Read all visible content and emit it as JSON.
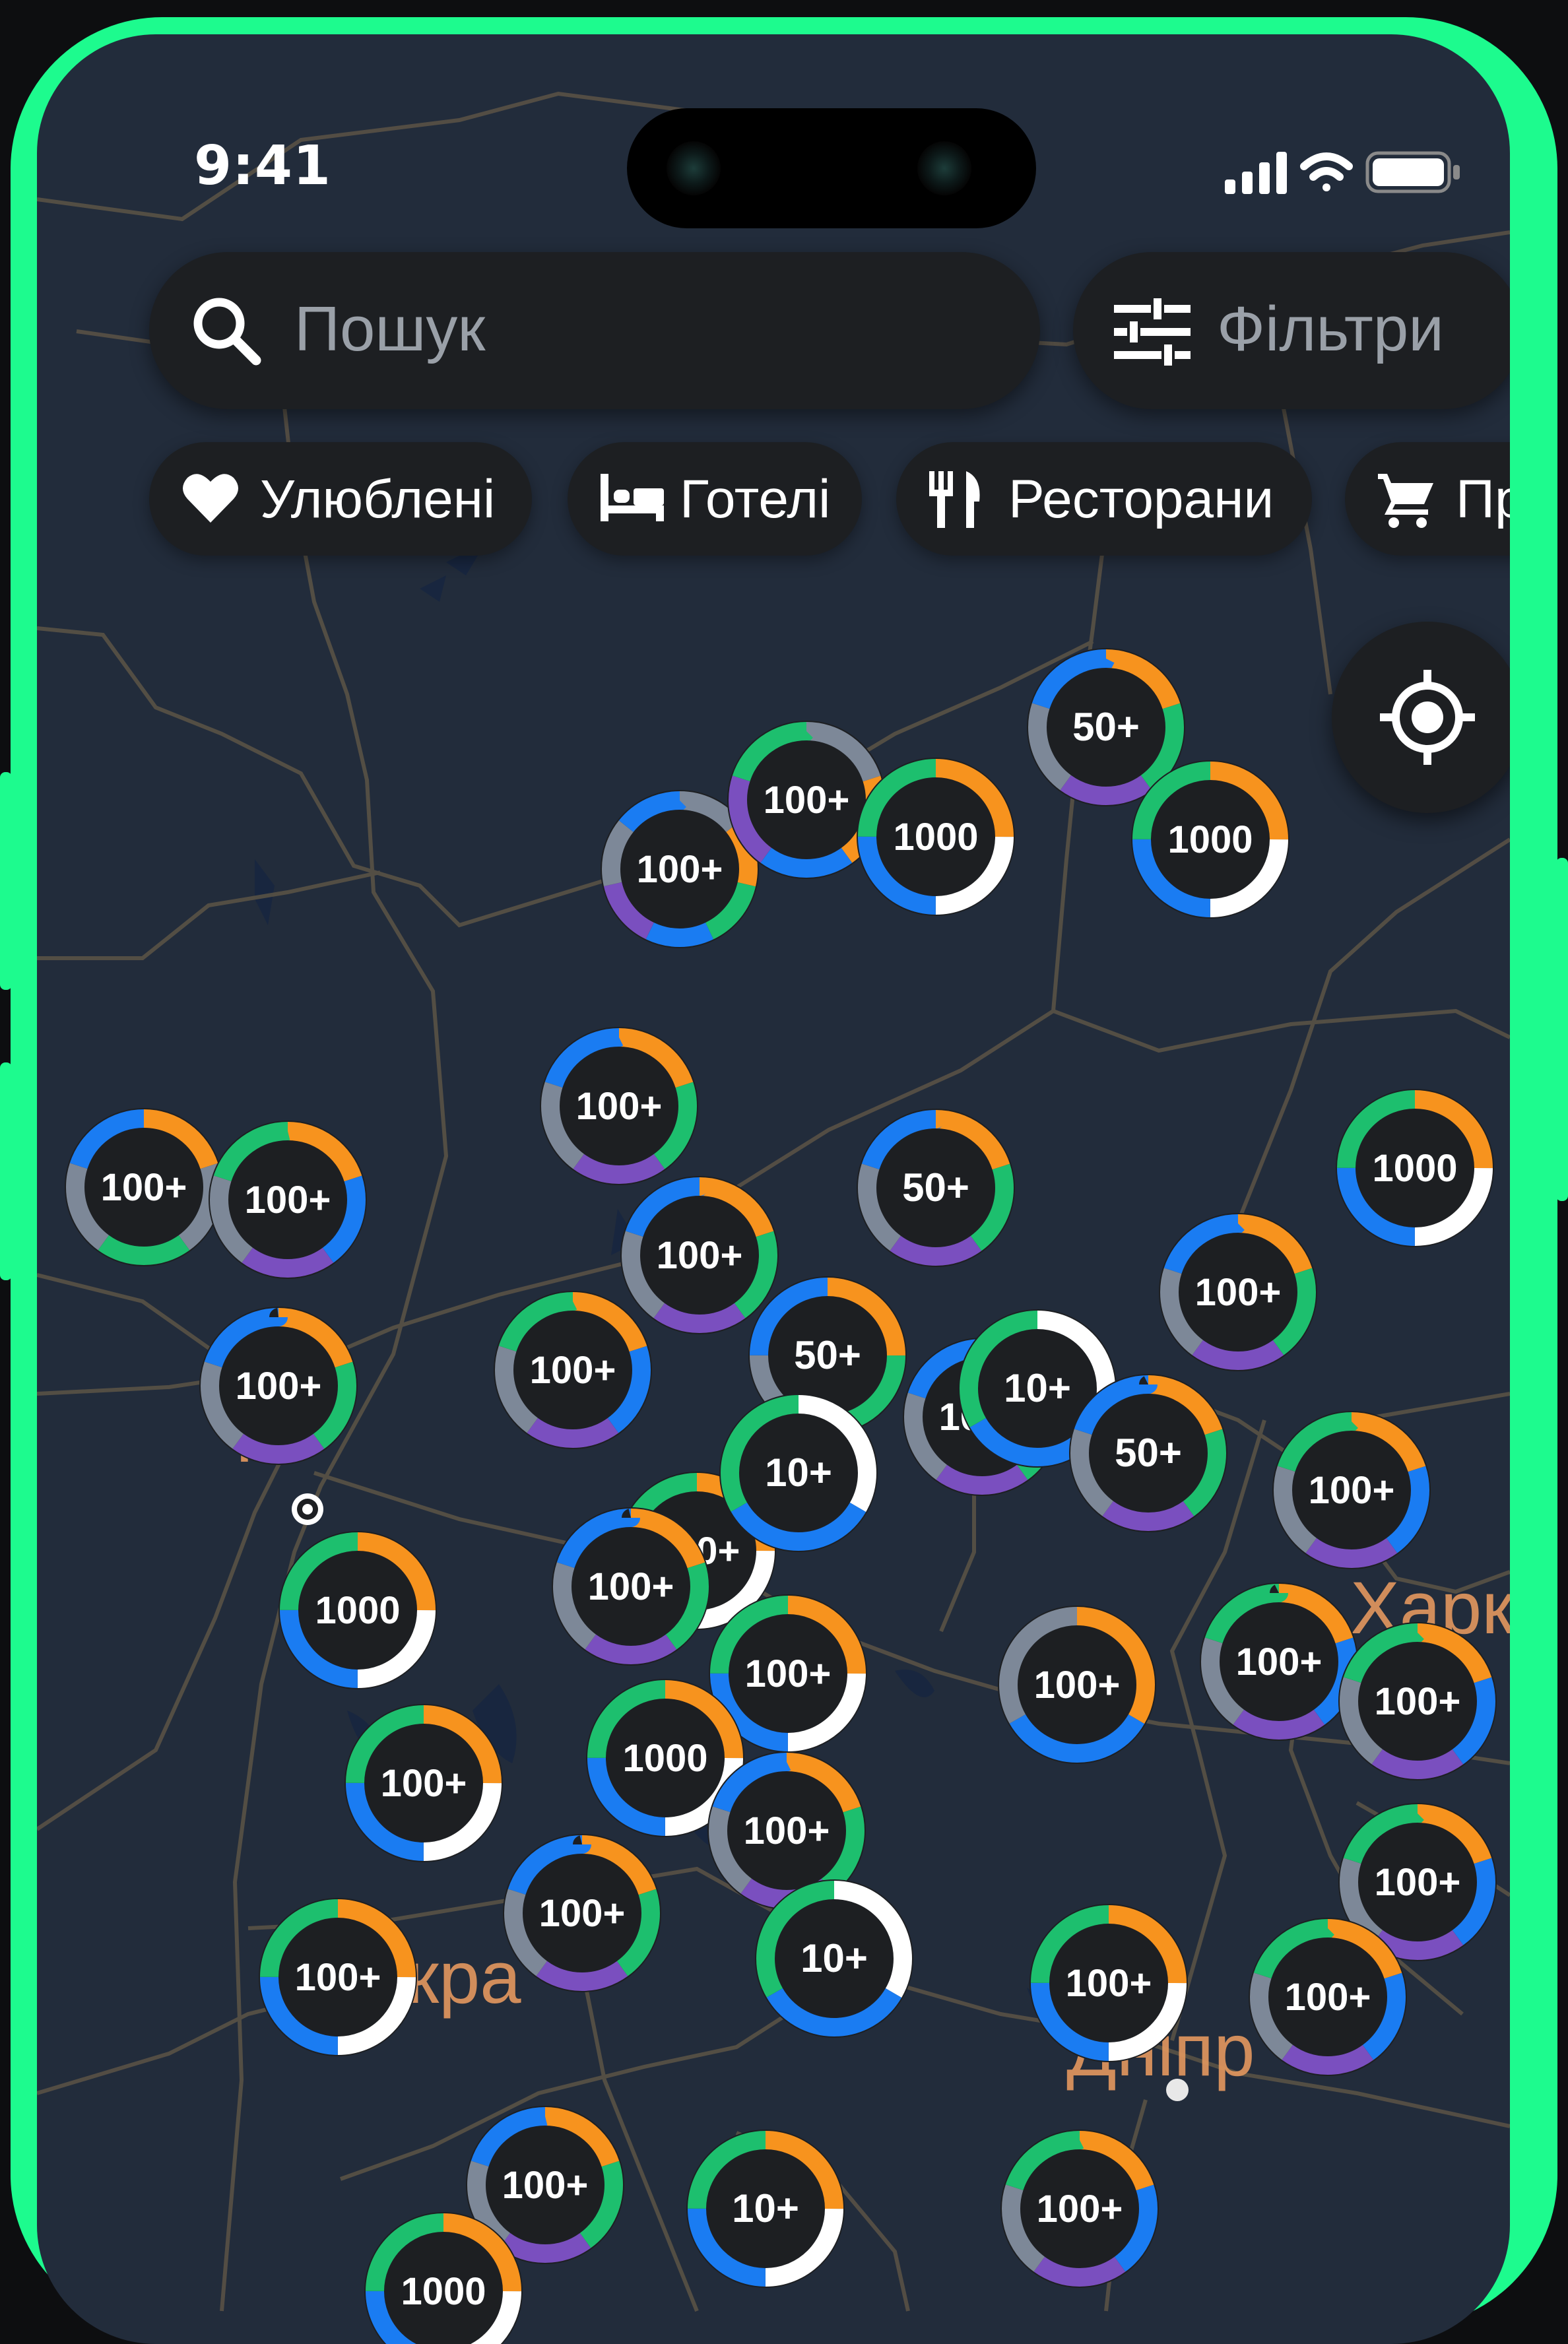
{
  "status": {
    "time": "9:41"
  },
  "search": {
    "placeholder": "Пошук"
  },
  "filters": {
    "label": "Фільтри"
  },
  "chips": [
    {
      "label": "Улюблені",
      "icon": "heart-icon"
    },
    {
      "label": "Готелі",
      "icon": "bed-icon"
    },
    {
      "label": "Ресторани",
      "icon": "fork-knife-icon"
    },
    {
      "label": "Про",
      "icon": "cart-icon"
    }
  ],
  "map": {
    "cities": [
      "К",
      "Харків",
      "кра",
      "Дніпр"
    ]
  },
  "colors": {
    "accent": "#1dfb8e",
    "orange": "#f7931e",
    "green": "#1dbf6e",
    "blue": "#1a7cf2",
    "purple": "#7a4fbf",
    "gray": "#7d8898",
    "white": "#ffffff"
  },
  "clusters": [
    {
      "label": "100+",
      "segments": [
        "gray",
        "orange",
        "green",
        "blue",
        "purple",
        "gray",
        "blue"
      ]
    },
    {
      "label": "100+",
      "segments": [
        "gray",
        "orange",
        "blue",
        "purple",
        "green"
      ]
    },
    {
      "label": "1000",
      "segments": [
        "orange",
        "white",
        "blue",
        "green"
      ]
    },
    {
      "label": "50+",
      "segments": [
        "orange",
        "green",
        "purple",
        "gray",
        "blue"
      ]
    },
    {
      "label": "1000",
      "segments": [
        "orange",
        "white",
        "blue",
        "green"
      ]
    },
    {
      "label": "100+",
      "segments": [
        "orange",
        "green",
        "purple",
        "gray",
        "blue"
      ]
    },
    {
      "label": "100+",
      "segments": [
        "orange",
        "gray",
        "green",
        "gray",
        "blue"
      ]
    },
    {
      "label": "100+",
      "segments": [
        "orange",
        "blue",
        "purple",
        "gray",
        "green"
      ]
    },
    {
      "label": "100+",
      "segments": [
        "orange",
        "green",
        "purple",
        "gray",
        "blue"
      ]
    },
    {
      "label": "50+",
      "segments": [
        "orange",
        "green",
        "purple",
        "gray",
        "blue"
      ]
    },
    {
      "label": "1000",
      "segments": [
        "orange",
        "white",
        "blue",
        "green"
      ]
    },
    {
      "label": "100+",
      "segments": [
        "orange",
        "green",
        "purple",
        "gray",
        "blue"
      ]
    },
    {
      "label": "100+",
      "segments": [
        "orange",
        "white",
        "blue",
        "green"
      ]
    },
    {
      "label": "50+",
      "segments": [
        "orange",
        "green",
        "gray",
        "blue"
      ]
    },
    {
      "label": "100+",
      "segments": [
        "orange",
        "green",
        "purple",
        "gray",
        "blue"
      ]
    },
    {
      "label": "10+",
      "segments": [
        "white",
        "blue",
        "green"
      ]
    },
    {
      "label": "10+",
      "segments": [
        "white",
        "blue",
        "green"
      ]
    },
    {
      "label": "50+",
      "segments": [
        "orange",
        "green",
        "purple",
        "gray",
        "blue"
      ]
    },
    {
      "label": "100+",
      "segments": [
        "orange",
        "blue",
        "purple",
        "gray",
        "green"
      ]
    },
    {
      "label": "100+",
      "segments": [
        "orange",
        "blue",
        "purple",
        "gray",
        "green"
      ]
    },
    {
      "label": "100+",
      "segments": [
        "orange",
        "green",
        "purple",
        "gray",
        "blue"
      ]
    },
    {
      "label": "1000",
      "segments": [
        "orange",
        "white",
        "blue",
        "green"
      ]
    },
    {
      "label": "100+",
      "segments": [
        "orange",
        "green",
        "purple",
        "gray",
        "blue"
      ]
    },
    {
      "label": "100+",
      "segments": [
        "orange",
        "blue",
        "gray"
      ]
    },
    {
      "label": "100+",
      "segments": [
        "orange",
        "blue",
        "purple",
        "gray",
        "green"
      ]
    },
    {
      "label": "100+",
      "segments": [
        "orange",
        "white",
        "blue",
        "green"
      ]
    },
    {
      "label": "1000",
      "segments": [
        "orange",
        "white",
        "blue",
        "green"
      ]
    },
    {
      "label": "100+",
      "segments": [
        "orange",
        "white",
        "blue",
        "green"
      ]
    },
    {
      "label": "100+",
      "segments": [
        "orange",
        "blue",
        "purple",
        "gray",
        "green"
      ]
    },
    {
      "label": "100+",
      "segments": [
        "orange",
        "green",
        "purple",
        "gray",
        "blue"
      ]
    },
    {
      "label": "100+",
      "segments": [
        "orange",
        "blue",
        "purple",
        "gray",
        "green"
      ]
    },
    {
      "label": "100+",
      "segments": [
        "orange",
        "green",
        "purple",
        "gray",
        "blue"
      ]
    },
    {
      "label": "10+",
      "segments": [
        "white",
        "blue",
        "green"
      ]
    },
    {
      "label": "100+",
      "segments": [
        "orange",
        "white",
        "blue",
        "green"
      ]
    },
    {
      "label": "100+",
      "segments": [
        "orange",
        "blue",
        "purple",
        "gray",
        "green"
      ]
    },
    {
      "label": "100+",
      "segments": [
        "orange",
        "white",
        "blue",
        "green"
      ]
    },
    {
      "label": "100+",
      "segments": [
        "orange",
        "green",
        "purple",
        "gray",
        "blue"
      ]
    },
    {
      "label": "10+",
      "segments": [
        "orange",
        "white",
        "blue",
        "green"
      ]
    },
    {
      "label": "100+",
      "segments": [
        "orange",
        "blue",
        "purple",
        "gray",
        "green"
      ]
    },
    {
      "label": "1000",
      "segments": [
        "orange",
        "white",
        "blue",
        "green"
      ]
    }
  ]
}
